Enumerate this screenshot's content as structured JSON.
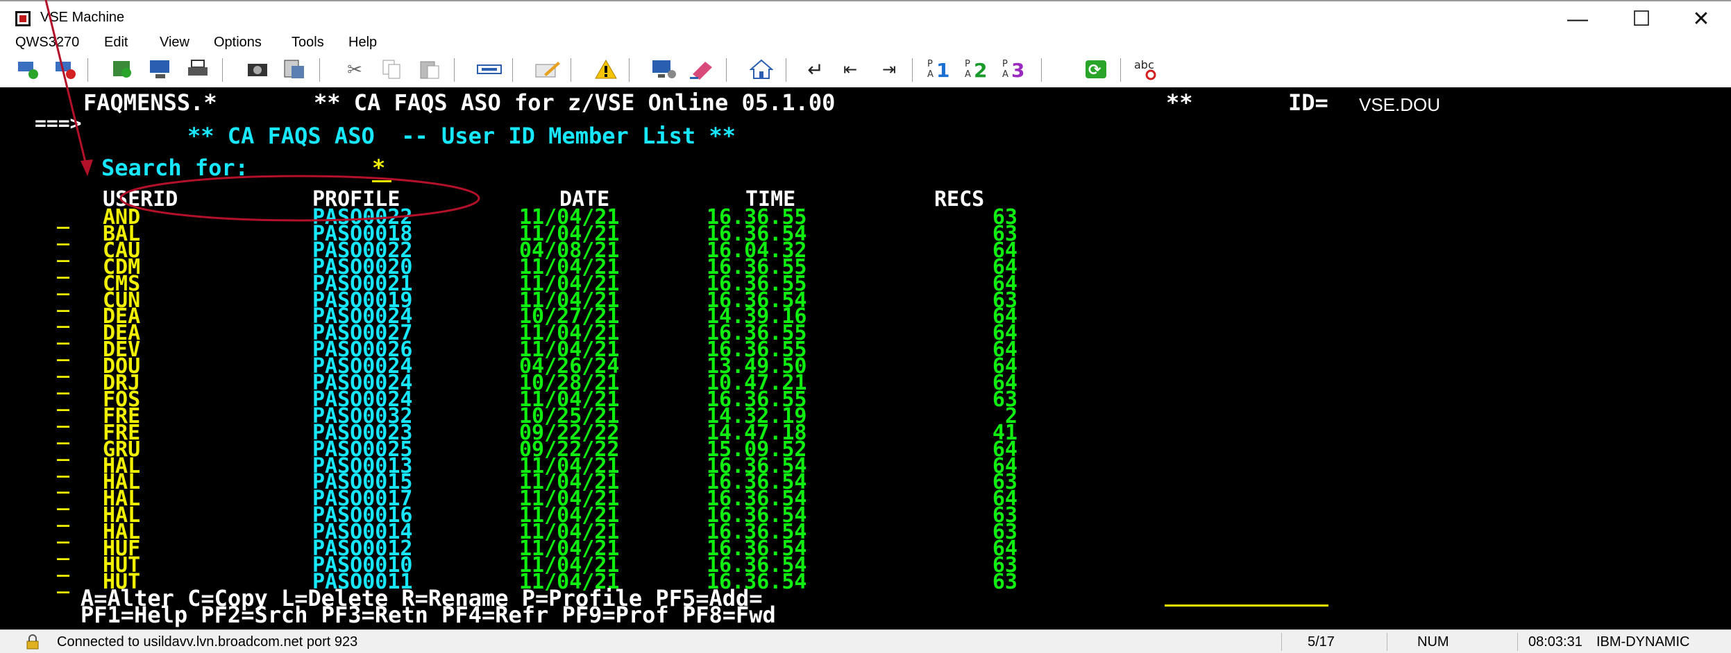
{
  "window": {
    "title": "VSE Machine",
    "controls": {
      "minimize": "—",
      "maximize": "☐",
      "close": "✕"
    }
  },
  "menu": [
    "QWS3270",
    "Edit",
    "View",
    "Options",
    "Tools",
    "Help"
  ],
  "toolbar": {
    "icons": [
      "connect-icon",
      "disconnect-icon",
      "run-icon",
      "print-screen-icon",
      "print-icon",
      "camera-icon",
      "capture-icon",
      "cut-icon",
      "copy-icon",
      "paste-icon",
      "keyboard-icon",
      "edit-icon",
      "warning-icon",
      "display-settings-icon",
      "eraser-icon",
      "home-icon",
      "enter-icon",
      "field-back-icon",
      "field-forward-icon",
      "pa1-icon",
      "pa2-icon",
      "pa3-icon",
      "refresh-icon",
      "spellcheck-icon"
    ],
    "pa_labels": [
      "1",
      "2",
      "3"
    ],
    "pa_prefix": "P\nA",
    "spell_label": "abc"
  },
  "terminal": {
    "header_program": "FAQMENSS.*",
    "header_title": "** CA FAQS ASO for z/VSE Online 05.1.00",
    "header_stars": "**",
    "header_id_label": "ID=",
    "header_id_value": "VSE.DOU",
    "command_prompt": "===>",
    "screen_title": "** CA FAQS ASO  -- User ID Member List **",
    "search_label": "Search for:",
    "search_value": "*",
    "columns": [
      "USERID",
      "PROFILE",
      "DATE",
      "TIME",
      "RECS"
    ],
    "rows": [
      {
        "userid": "AND",
        "profile": "PASO0022",
        "date": "11/04/21",
        "time": "16.36.55",
        "recs": "63"
      },
      {
        "userid": "BAL",
        "profile": "PASO0018",
        "date": "11/04/21",
        "time": "16.36.54",
        "recs": "63"
      },
      {
        "userid": "CAU",
        "profile": "PASO0022",
        "date": "04/08/21",
        "time": "16.04.32",
        "recs": "64"
      },
      {
        "userid": "CDM",
        "profile": "PASO0020",
        "date": "11/04/21",
        "time": "16.36.55",
        "recs": "64"
      },
      {
        "userid": "CMS",
        "profile": "PASO0021",
        "date": "11/04/21",
        "time": "16.36.55",
        "recs": "64"
      },
      {
        "userid": "CUN",
        "profile": "PASO0019",
        "date": "11/04/21",
        "time": "16.36.54",
        "recs": "63"
      },
      {
        "userid": "DEA",
        "profile": "PASO0024",
        "date": "10/27/21",
        "time": "14.39.16",
        "recs": "64"
      },
      {
        "userid": "DEA",
        "profile": "PASO0027",
        "date": "11/04/21",
        "time": "16.36.55",
        "recs": "64"
      },
      {
        "userid": "DEV",
        "profile": "PASO0026",
        "date": "11/04/21",
        "time": "16.36.55",
        "recs": "64"
      },
      {
        "userid": "DOU",
        "profile": "PASO0024",
        "date": "04/26/24",
        "time": "13.49.50",
        "recs": "64"
      },
      {
        "userid": "DRJ",
        "profile": "PASO0024",
        "date": "10/28/21",
        "time": "10.47.21",
        "recs": "64"
      },
      {
        "userid": "FOS",
        "profile": "PASO0024",
        "date": "11/04/21",
        "time": "16.36.55",
        "recs": "63"
      },
      {
        "userid": "FRE",
        "profile": "PASO0032",
        "date": "10/25/21",
        "time": "14.32.19",
        "recs": "2"
      },
      {
        "userid": "FRE",
        "profile": "PASO0023",
        "date": "09/22/22",
        "time": "14.47.18",
        "recs": "41"
      },
      {
        "userid": "GRU",
        "profile": "PASO0025",
        "date": "09/22/22",
        "time": "15.09.52",
        "recs": "64"
      },
      {
        "userid": "HAL",
        "profile": "PASO0013",
        "date": "11/04/21",
        "time": "16.36.54",
        "recs": "64"
      },
      {
        "userid": "HAL",
        "profile": "PASO0015",
        "date": "11/04/21",
        "time": "16.36.54",
        "recs": "63"
      },
      {
        "userid": "HAL",
        "profile": "PASO0017",
        "date": "11/04/21",
        "time": "16.36.54",
        "recs": "64"
      },
      {
        "userid": "HAL",
        "profile": "PASO0016",
        "date": "11/04/21",
        "time": "16.36.54",
        "recs": "63"
      },
      {
        "userid": "HAL",
        "profile": "PASO0014",
        "date": "11/04/21",
        "time": "16.36.54",
        "recs": "63"
      },
      {
        "userid": "HUF",
        "profile": "PASO0012",
        "date": "11/04/21",
        "time": "16.36.54",
        "recs": "64"
      },
      {
        "userid": "HUT",
        "profile": "PASO0010",
        "date": "11/04/21",
        "time": "16.36.54",
        "recs": "63"
      },
      {
        "userid": "HUT",
        "profile": "PASO0011",
        "date": "11/04/21",
        "time": "16.36.54",
        "recs": "63"
      }
    ],
    "row_selector": "_",
    "legend_line": "A=Alter C=Copy L=Delete R=Rename P=Profile PF5=Add=",
    "pf_line": "PF1=Help PF2=Srch PF3=Retn PF4=Refr PF9=Prof PF8=Fwd",
    "colors": {
      "background": "#000000",
      "yellow": "#f0f000",
      "cyan": "#18e8ff",
      "green": "#10f010",
      "white": "#ffffff",
      "annotation": "#b3102a"
    }
  },
  "statusbar": {
    "connection": "Connected to usildavv.lvn.broadcom.net port 923",
    "cursor": "5/17",
    "num": "NUM",
    "time": "08:03:31",
    "host": "IBM-DYNAMIC"
  }
}
